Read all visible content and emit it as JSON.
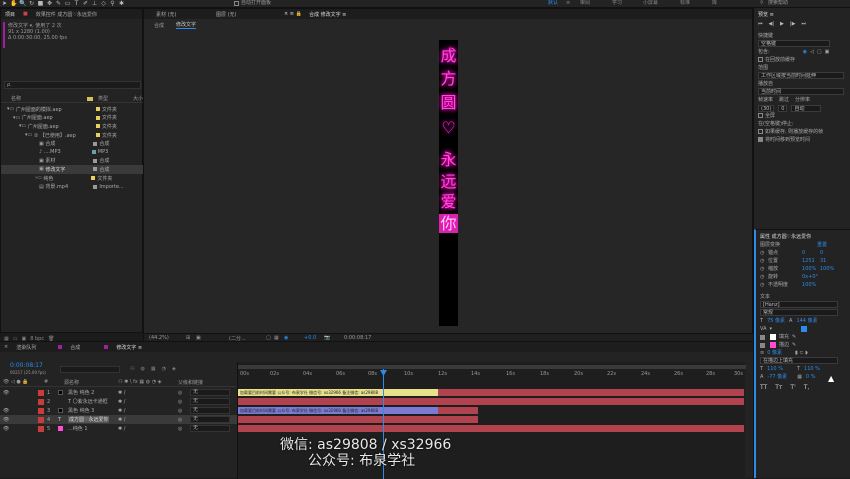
{
  "toolbar": {
    "snap_label": "自动打开面板",
    "workspaces": [
      "默认",
      "≡",
      "审阅",
      "学习",
      "小屏幕",
      "标准",
      "库"
    ],
    "search": "搜索帮助"
  },
  "project": {
    "title": "项目",
    "title_extra": "效果控件 成方圆♡永远爱你",
    "comp_name": "修改文字 ▾",
    "comp_used": ", 使用了 2 次",
    "comp_size": "91 x 1280 (1.00)",
    "comp_duration": "Δ 0:00:30:00, 25.00 fps",
    "search_placeholder": "ρ.",
    "col_name": "名称",
    "col_type": "类型",
    "col_size": "大小",
    "items": [
      {
        "name": "广州屋面的模拟.aep",
        "type": "文件夹",
        "color": "#e8d25a",
        "indent": 0
      },
      {
        "name": "广州屋面.aep",
        "type": "文件夹",
        "color": "#e8d25a",
        "indent": 1
      },
      {
        "name": "广州屋面.aep",
        "type": "文件夹",
        "color": "#e8d25a",
        "indent": 2
      },
      {
        "name": "② 【已使用】.aep",
        "type": "文件夹",
        "color": "#e8d25a",
        "indent": 3
      },
      {
        "name": "合成",
        "type": "合成",
        "color": "#9a9a9a",
        "indent": 4
      },
      {
        "name": "....MP3",
        "type": "MP3",
        "color": "#6aa0a0",
        "indent": 4
      },
      {
        "name": "素材",
        "type": "合成",
        "color": "#9a9a9a",
        "indent": 4
      },
      {
        "name": "修改文字",
        "type": "合成",
        "color": "#9a9a9a",
        "indent": 4,
        "selected": true
      },
      {
        "name": "纯色",
        "type": "文件夹",
        "color": "#e8d25a",
        "indent": 4
      },
      {
        "name": "背景.mp4",
        "type": "Importe...",
        "color": "#9a9a9a",
        "indent": 4
      }
    ],
    "footer": "8 bpc"
  },
  "viewer": {
    "tabs": [
      "素材 (无)",
      "图层 (无)",
      "合成 修改文字 ≡"
    ],
    "breadcrumbs": [
      "合成",
      "修改文字"
    ],
    "text_chars": [
      "成",
      "方",
      "圆",
      "♡",
      "永",
      "远",
      "爱",
      "你"
    ],
    "zoom": "(44.2%)",
    "quality": "(二分...",
    "exposure": "+0.0",
    "time": "0:00:08:17"
  },
  "timeline": {
    "tabs": [
      "渲染队列",
      "合成",
      "修改文字 ≡"
    ],
    "timecode": "0:00:08:17",
    "timecode_sub": "00217 (25.00 fps)",
    "col_layer_name": "源名称",
    "col_parent": "父级和链接",
    "ruler": [
      "00s",
      "02s",
      "04s",
      "06s",
      "08s",
      "10s",
      "12s",
      "14s",
      "16s",
      "18s",
      "20s",
      "22s",
      "24s",
      "26s",
      "28s",
      "30s"
    ],
    "layers": [
      {
        "num": "1",
        "name": "黑色 纯色 2",
        "color": "#c83c3c",
        "parent": "无",
        "icon": "#000000"
      },
      {
        "name": "T 〇紫永远卡通框",
        "num": "2",
        "color": "#c83c3c",
        "parent": "无",
        "icon": "#777777"
      },
      {
        "num": "3",
        "name": "黑色 纯色 3",
        "color": "#c83c3c",
        "parent": "无",
        "icon": "#000000"
      },
      {
        "num": "4",
        "name": "成方圆♡永远爱你",
        "color": "#c83c3c",
        "parent": "无",
        "icon": "#777777",
        "selected": true
      },
      {
        "num": "5",
        "name": "...纯色 1",
        "color": "#c83c3c",
        "parent": "无",
        "icon": "#ff4bd8"
      }
    ],
    "bar_text_1": "加载要目前时间需要  公众号: 布泉学社  微信号: xs32966  备注微信: as29808",
    "bar_text_2": "加载要目前时间需要  公众号: 布泉学社  微信号: xs32966  备注微信: as29808"
  },
  "preview": {
    "title": "预览 ≡",
    "shortcut_label": "快捷键",
    "shortcut": "空格键",
    "include": "包含:",
    "cache_before": "在回放前缓存",
    "range_label": "范围",
    "range": "工作区域按当前时间延伸",
    "play_from_label": "播放自",
    "play_from": "当前时间",
    "fps_label": "帧速率",
    "skip_label": "跳过",
    "res_label": "分辨率",
    "fps": "(30)",
    "skip": "0",
    "res": "自动",
    "fullscreen": "全屏",
    "stop_label": "在(空格键)停止:",
    "stop_opt1": "如果缓存, 则播放缓存的帧",
    "stop_opt2": "将时间移到预览时间"
  },
  "properties": {
    "title": "属性 成方圆♡永远爱你",
    "transform": "图层变换",
    "reset": "重置",
    "anchor_label": "锚点",
    "anchor": [
      "0",
      "0"
    ],
    "position_label": "位置",
    "position": [
      "1251",
      "31"
    ],
    "scale_label": "缩放",
    "scale": [
      "100%",
      "100%"
    ],
    "rotation_label": "旋转",
    "rotation": "0x+0°",
    "opacity_label": "不透明度",
    "opacity": "100%",
    "text_label": "文本",
    "font": "[Hanz]",
    "style": "常规",
    "font_size": "75 像素",
    "leading": "144 像素",
    "fill_label": "填充",
    "stroke_label": "描边",
    "stroke_px": "0 像素",
    "stroke_pos": "在描边上填充",
    "tracking": "110 %",
    "kerning": "110 %",
    "baseline": "-77 像素",
    "tsume": "0 %",
    "text_btns": [
      "TT",
      "Tт",
      "T'",
      "T,"
    ]
  },
  "watermark": {
    "line1": "微信: as29808 / xs32966",
    "line2": "公众号: 布泉学社"
  }
}
